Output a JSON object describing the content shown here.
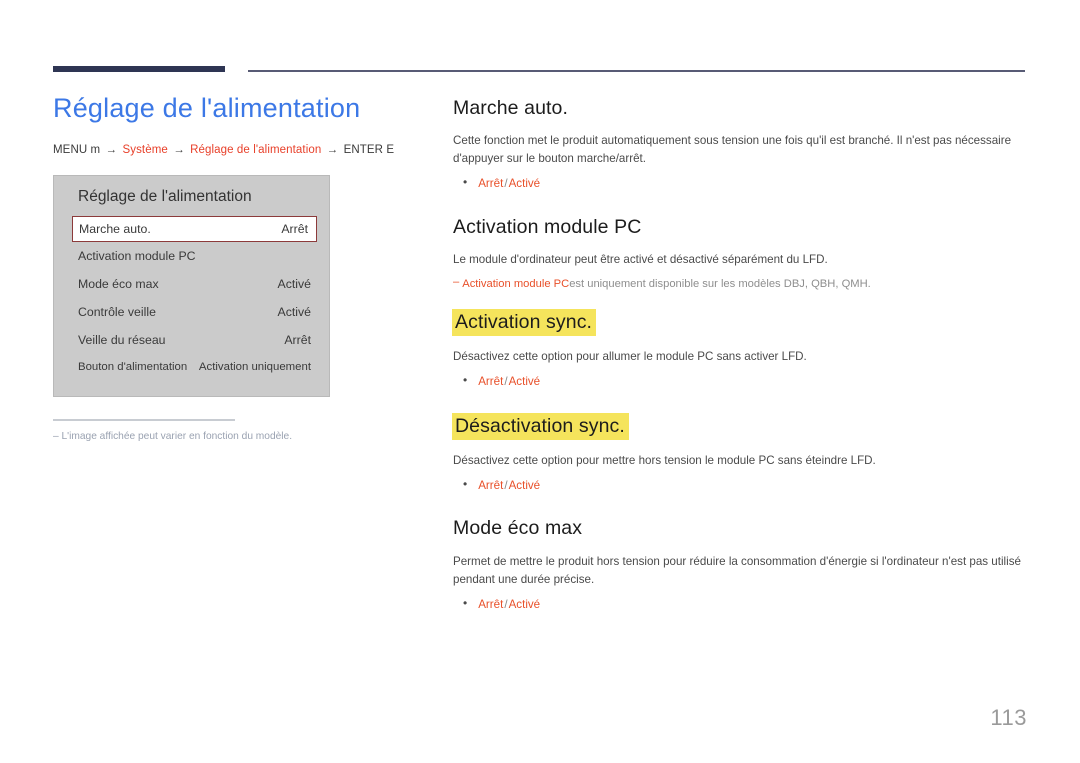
{
  "page": {
    "title": "Réglage de l'alimentation",
    "number": "113"
  },
  "breadcrumb": {
    "start": "MENU m",
    "arrow": "→",
    "step1": "Système",
    "step2": "Réglage de l'alimentation",
    "end": "ENTER E"
  },
  "osd": {
    "title": "Réglage de l'alimentation",
    "rows": [
      {
        "label": "Marche auto.",
        "value": "Arrêt",
        "selected": true
      },
      {
        "label": "Activation module PC",
        "value": "",
        "selected": false
      },
      {
        "label": "Mode éco max",
        "value": "Activé",
        "selected": false
      },
      {
        "label": "Contrôle veille",
        "value": "Activé",
        "selected": false
      },
      {
        "label": "Veille du réseau",
        "value": "Arrêt",
        "selected": false
      },
      {
        "label": "Bouton d'alimentation",
        "value": "Activation uniquement",
        "selected": false
      }
    ]
  },
  "footnote": {
    "text": "‒  L'image affichée peut varier en fonction du modèle."
  },
  "sections": [
    {
      "heading": "Marche auto.",
      "highlight": false,
      "body": "Cette fonction met le produit automatiquement sous tension une fois qu'il est branché. Il n'est pas nécessaire d'appuyer sur le bouton marche/arrêt.",
      "options": {
        "off": "Arrêt",
        "sep": "/",
        "on": "Activé"
      }
    },
    {
      "heading": "Activation module PC",
      "highlight": false,
      "body": "Le module d'ordinateur peut être activé et désactivé séparément du LFD.",
      "note": {
        "dash": "‒",
        "red": "Activation module PC",
        "rest": "est uniquement disponible sur les modèles DBJ, QBH, QMH."
      }
    },
    {
      "heading": "Activation sync.",
      "highlight": true,
      "body": "Désactivez cette option pour allumer le module PC sans activer LFD.",
      "options": {
        "off": "Arrêt",
        "sep": "/",
        "on": "Activé"
      }
    },
    {
      "heading": "Désactivation sync.",
      "highlight": true,
      "body": "Désactivez cette option pour mettre hors tension le module PC sans éteindre LFD.",
      "options": {
        "off": "Arrêt",
        "sep": "/",
        "on": "Activé"
      }
    },
    {
      "heading": "Mode éco max",
      "highlight": false,
      "body": "Permet de mettre le produit hors tension pour réduire la consommation d'énergie si l'ordinateur n'est pas utilisé pendant une durée précise.",
      "options": {
        "off": "Arrêt",
        "sep": "/",
        "on": "Activé"
      }
    }
  ],
  "colors": {
    "title_blue": "#3c78e6",
    "accent_red": "#e8502a",
    "highlight_yellow": "#f5e45c",
    "rule_navy": "#2e3553",
    "panel_gray": "#cbcbcb"
  }
}
